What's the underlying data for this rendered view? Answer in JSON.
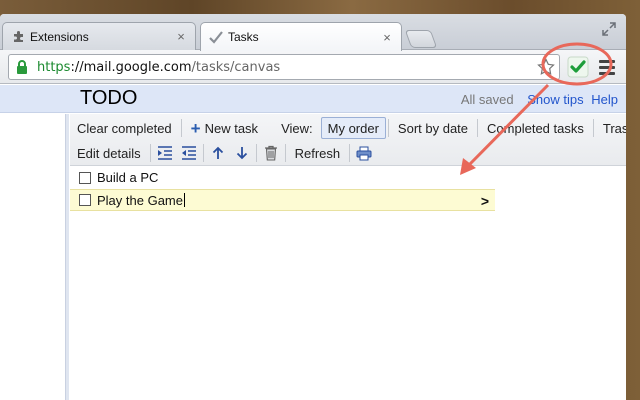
{
  "tabs": [
    {
      "label": "Extensions",
      "icon": "puzzle-icon",
      "close": "×"
    },
    {
      "label": "Tasks",
      "icon": "tasks-check-icon",
      "close": "×",
      "active": true
    }
  ],
  "address_bar": {
    "scheme": "https",
    "separator": "://",
    "host": "mail.google.com",
    "path": "/tasks/canvas"
  },
  "header": {
    "title": "TODO",
    "status": "All saved",
    "show_tips": "Show tips",
    "help": "Help"
  },
  "toolbar": {
    "clear_completed": "Clear completed",
    "new_task": "New task",
    "plus": "+",
    "view_label": "View:",
    "my_order": "My order",
    "sort_by_date": "Sort by date",
    "completed_tasks": "Completed tasks",
    "trash": "Trash",
    "edit_details": "Edit details",
    "refresh": "Refresh"
  },
  "tasks": [
    {
      "text": "Build a PC",
      "checked": false
    },
    {
      "text": "Play the Game",
      "checked": false,
      "active": true,
      "chevron": ">"
    }
  ],
  "colors": {
    "accent_blue_bar": "#dde6f7",
    "annotation_red": "#e8685a",
    "extension_check_green": "#1e9e3a",
    "url_scheme_green": "#1b8a2f",
    "active_row_yellow": "#fdfbd3"
  }
}
